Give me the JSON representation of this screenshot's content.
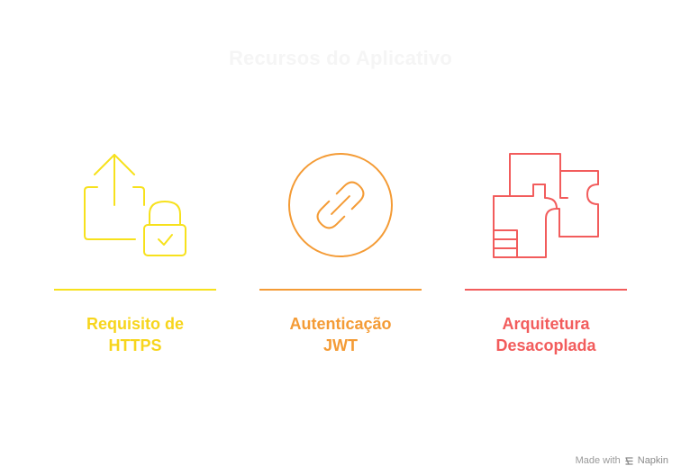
{
  "title": "Recursos do Aplicativo",
  "columns": [
    {
      "label": "Requisito de\nHTTPS",
      "color": "#f7e11c",
      "icon": "upload-lock-icon"
    },
    {
      "label": "Autenticação\nJWT",
      "color": "#f49b35",
      "icon": "chain-link-icon"
    },
    {
      "label": "Arquitetura\nDesacoplada",
      "color": "#f25c5c",
      "icon": "floor-plan-icon"
    }
  ],
  "footer": {
    "prefix": "Made with",
    "brand": "Napkin",
    "icon": "napkin-logo-icon"
  }
}
